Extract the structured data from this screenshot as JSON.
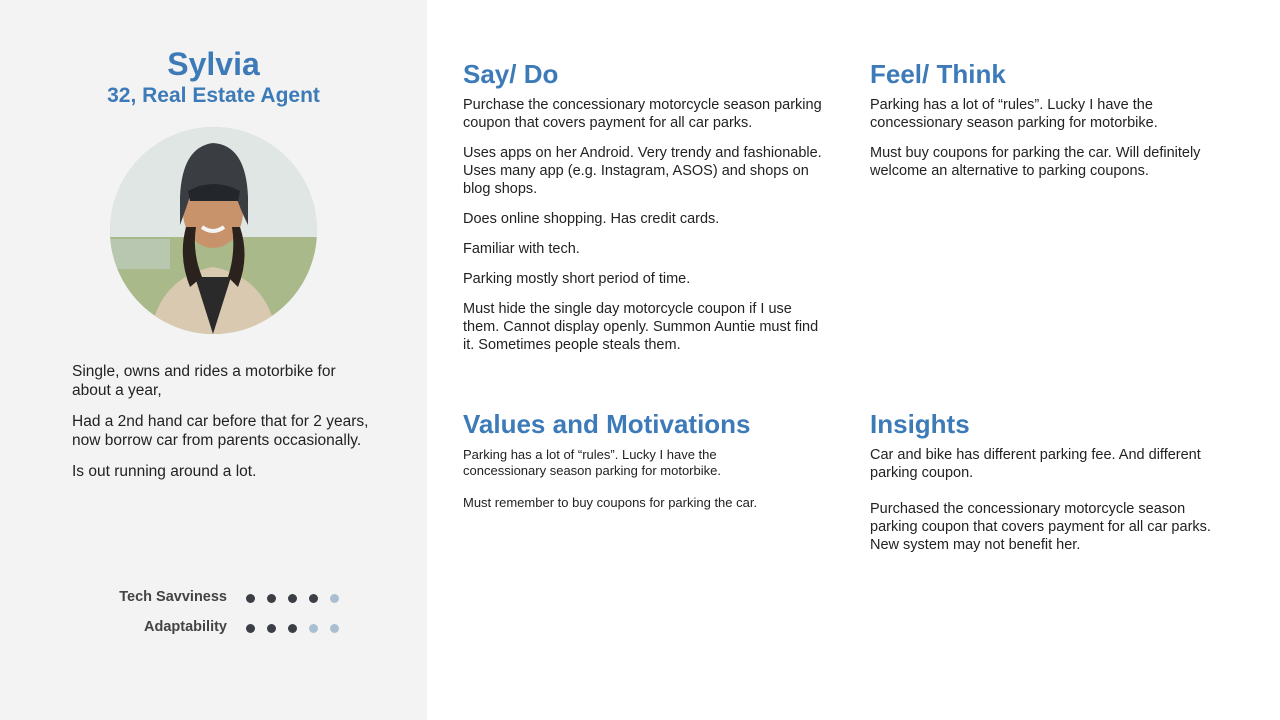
{
  "persona": {
    "name": "Sylvia",
    "subtitle": "32, Real Estate Agent",
    "bio": [
      "Single, owns and rides a motorbike for about a year,",
      "Had a 2nd hand car before that for 2 years, now borrow car from parents occasionally.",
      "Is out running around a lot."
    ],
    "ratings": [
      {
        "label": "Tech Savviness",
        "value": 4,
        "max": 5
      },
      {
        "label": "Adaptability",
        "value": 3,
        "max": 5
      }
    ]
  },
  "colors": {
    "accent": "#3d7ab8",
    "dot_filled": "#3b3f45",
    "dot_empty": "#a9bfd1",
    "sidebar_bg": "#f3f3f3"
  },
  "sections": {
    "say_do": {
      "title": "Say/ Do",
      "items": [
        "Purchase the concessionary motorcycle season parking coupon that covers payment for all car parks.",
        "Uses apps on her Android. Very trendy and fashionable. Uses many app (e.g. Instagram, ASOS) and shops on blog shops.",
        "Does online shopping. Has credit cards.",
        "Familiar with tech.",
        "Parking mostly short period of time.",
        "Must hide the single day motorcycle coupon if I use them. Cannot display openly. Summon Auntie must find it. Sometimes people steals them."
      ]
    },
    "feel_think": {
      "title": "Feel/ Think",
      "items": [
        "Parking has a lot of “rules”. Lucky I have the concessionary season parking for motorbike.",
        "Must buy coupons for parking the car. Will definitely welcome an alternative to parking coupons."
      ]
    },
    "values": {
      "title": "Values and Motivations",
      "items": [
        "Parking has a lot of “rules”. Lucky I have the concessionary season parking for motorbike.",
        "Must remember to buy coupons for parking the car."
      ]
    },
    "insights": {
      "title": "Insights",
      "items": [
        "Car and bike has different parking fee. And different parking coupon.",
        "Purchased the concessionary motorcycle season parking coupon that covers payment for all car parks. New system may not benefit her."
      ]
    }
  }
}
